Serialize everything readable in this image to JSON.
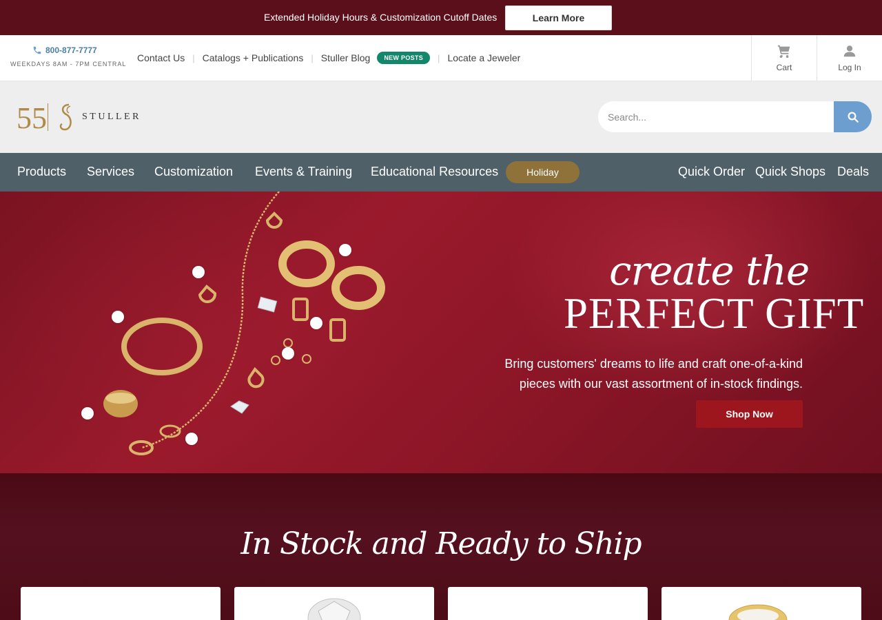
{
  "announcement": {
    "text": "Extended Holiday Hours & Customization Cutoff Dates",
    "button_label": "Learn More"
  },
  "utility": {
    "phone": "800-877-7777",
    "hours": "WEEKDAYS 8AM - 7PM CENTRAL",
    "links": [
      "Contact Us",
      "Catalogs + Publications",
      "Stuller Blog",
      "Locate a Jeweler"
    ],
    "blog_badge": "NEW POSTS",
    "cart_label": "Cart",
    "login_label": "Log In"
  },
  "brand": {
    "wordmark": "STULLER",
    "anniversary_mark": "55"
  },
  "search": {
    "placeholder": "Search..."
  },
  "nav": {
    "left_items": [
      "Products",
      "Services",
      "Customization",
      "Events & Training",
      "Educational Resources"
    ],
    "holiday_label": "Holiday",
    "right_items": [
      "Quick Order",
      "Quick Shops",
      "Deals"
    ]
  },
  "hero": {
    "script_line": "create the",
    "title_line": "PERFECT GIFT",
    "body": "Bring customers' dreams to life and craft one-of-a-kind pieces with our vast assortment of in-stock findings.",
    "button_label": "Shop Now"
  },
  "instock": {
    "title": "In Stock and Ready to Ship"
  },
  "colors": {
    "announcement_bg": "#5b0f1b",
    "nav_bg": "#506068",
    "holiday_pill": "#8e7239",
    "badge_green": "#12876a",
    "search_button": "#6c9fcf",
    "shop_button": "#9d151d",
    "brand_gold": "#b08a4a"
  },
  "icons": [
    "phone-icon",
    "cart-icon",
    "user-icon",
    "search-icon"
  ]
}
